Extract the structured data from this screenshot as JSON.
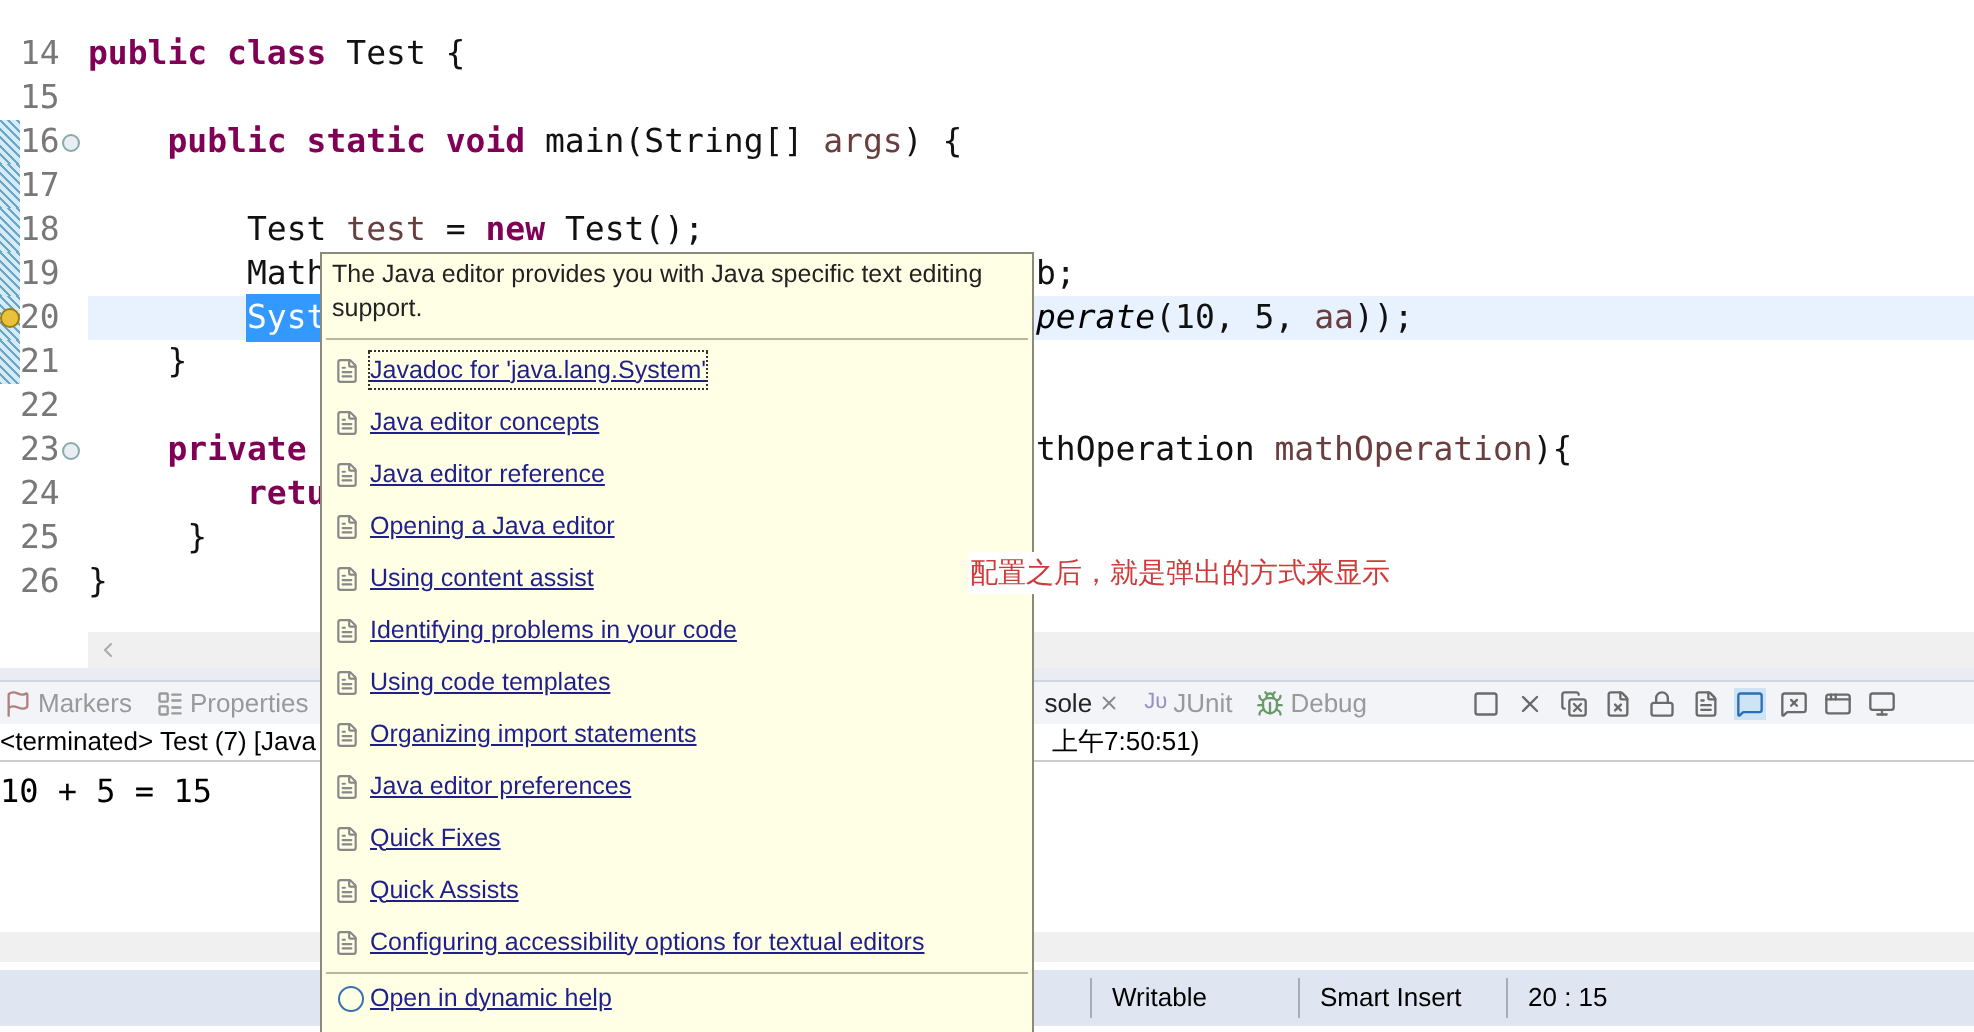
{
  "editor": {
    "lines": [
      {
        "number": "14",
        "fold": false,
        "changed": false,
        "warning": false,
        "current": false,
        "segments": [
          {
            "text": "public class ",
            "kind": "keyword"
          },
          {
            "text": "Test {",
            "kind": "plain"
          }
        ]
      },
      {
        "number": "15",
        "fold": false,
        "changed": false,
        "warning": false,
        "current": false
      },
      {
        "number": "16",
        "fold": true,
        "changed": true,
        "warning": false,
        "current": false,
        "segments": [
          {
            "text": "    public static void ",
            "kind": "keyword"
          },
          {
            "text": "main(String[] ",
            "kind": "plain"
          },
          {
            "text": "args",
            "kind": "variable"
          },
          {
            "text": ") {",
            "kind": "plain"
          }
        ]
      },
      {
        "number": "17",
        "fold": false,
        "changed": true,
        "warning": false,
        "current": false
      },
      {
        "number": "18",
        "fold": false,
        "changed": true,
        "warning": false,
        "current": false,
        "segments": [
          {
            "text": "        Test ",
            "kind": "plain"
          },
          {
            "text": "test",
            "kind": "variable"
          },
          {
            "text": " = ",
            "kind": "plain"
          },
          {
            "text": "new ",
            "kind": "keyword"
          },
          {
            "text": "Test();",
            "kind": "plain"
          }
        ]
      },
      {
        "number": "19",
        "fold": false,
        "changed": true,
        "warning": false,
        "current": false,
        "segments": [
          {
            "text": "        Math",
            "kind": "plain"
          }
        ],
        "right_segments": [
          {
            "text": "b;",
            "kind": "plain"
          }
        ]
      },
      {
        "number": "20",
        "fold": false,
        "changed": true,
        "warning": true,
        "current": true,
        "segments": [
          {
            "text": "        Syst",
            "kind": "selected"
          }
        ],
        "right_segments": [
          {
            "text": "perate",
            "kind": "italic"
          },
          {
            "text": "(10, 5, ",
            "kind": "plain"
          },
          {
            "text": "aa",
            "kind": "variable"
          },
          {
            "text": "));",
            "kind": "plain"
          }
        ]
      },
      {
        "number": "21",
        "fold": false,
        "changed": true,
        "warning": false,
        "current": false,
        "segments": [
          {
            "text": "    }",
            "kind": "plain"
          }
        ]
      },
      {
        "number": "22",
        "fold": false,
        "changed": false,
        "warning": false,
        "current": false
      },
      {
        "number": "23",
        "fold": true,
        "changed": false,
        "warning": false,
        "current": false,
        "segments": [
          {
            "text": "    private",
            "kind": "keyword"
          }
        ],
        "right_segments": [
          {
            "text": "thOperation ",
            "kind": "plain"
          },
          {
            "text": "mathOperation",
            "kind": "variable"
          },
          {
            "text": "){",
            "kind": "plain"
          }
        ]
      },
      {
        "number": "24",
        "fold": false,
        "changed": false,
        "warning": false,
        "current": false,
        "segments": [
          {
            "text": "        retu",
            "kind": "keyword"
          }
        ]
      },
      {
        "number": "25",
        "fold": false,
        "changed": false,
        "warning": false,
        "current": false,
        "segments": [
          {
            "text": "     }",
            "kind": "plain"
          }
        ]
      },
      {
        "number": "26",
        "fold": false,
        "changed": false,
        "warning": false,
        "current": false,
        "segments": [
          {
            "text": "}",
            "kind": "plain"
          }
        ]
      }
    ]
  },
  "annotation": "配置之后，就是弹出的方式来显示",
  "panel": {
    "tabs": [
      {
        "label": "Markers",
        "selected": false
      },
      {
        "label": "Properties",
        "selected": false
      },
      {
        "label": "sole",
        "selected": true
      },
      {
        "label": "JUnit",
        "selected": false,
        "icon_text": "Jυ"
      },
      {
        "label": "Debug",
        "selected": false
      }
    ],
    "console_title_left": "<terminated> Test (7) [Java",
    "console_title_right": "上午7:50:51)",
    "output": "10 + 5 = 15"
  },
  "status_bar": [
    "Writable",
    "Smart Insert",
    "20 : 15"
  ],
  "popup": {
    "description": "The Java editor provides you with Java specific text editing support.",
    "links": [
      {
        "label": "Javadoc for 'java.lang.System'",
        "focused": true
      },
      {
        "label": "Java editor concepts",
        "focused": false
      },
      {
        "label": "Java editor reference",
        "focused": false
      },
      {
        "label": "Opening a Java editor",
        "focused": false
      },
      {
        "label": "Using content assist",
        "focused": false
      },
      {
        "label": "Identifying problems in your code",
        "focused": false
      },
      {
        "label": "Using code templates",
        "focused": false
      },
      {
        "label": "Organizing import statements",
        "focused": false
      },
      {
        "label": "Java editor preferences",
        "focused": false
      },
      {
        "label": "Quick Fixes",
        "focused": false
      },
      {
        "label": "Quick Assists",
        "focused": false
      },
      {
        "label": "Configuring accessibility options for textual editors",
        "focused": false
      }
    ],
    "help_link": "Open in dynamic help"
  }
}
